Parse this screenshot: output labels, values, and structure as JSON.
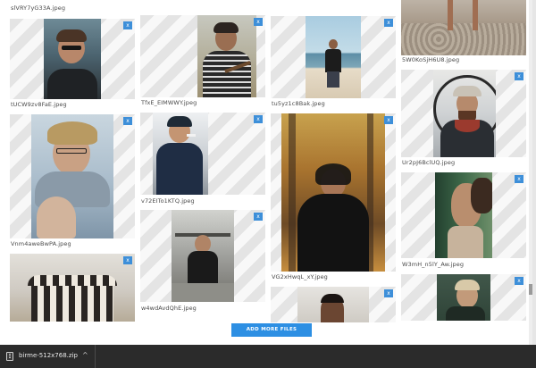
{
  "files": [
    {
      "name": "slVRY7yG33A.jpeg"
    },
    {
      "name": "tUCW9zv8FaE.jpeg"
    },
    {
      "name": "Vnm4aweBwPA.jpeg"
    },
    {
      "name": ""
    },
    {
      "name": ""
    },
    {
      "name": "TfxE_EIMWWY.jpeg"
    },
    {
      "name": "v72EITo1KTQ.jpeg"
    },
    {
      "name": "w4wdAvdQhE.jpeg"
    },
    {
      "name": ""
    },
    {
      "name": "tu5yz1c8Bak.jpeg"
    },
    {
      "name": "VG2xHwqL_xY.jpeg"
    },
    {
      "name": ""
    },
    {
      "name": "5W0KoSjH6U8.jpeg"
    },
    {
      "name": "Ur2pJ6BclUQ.jpeg"
    },
    {
      "name": "W3mH_n5lY_Aw.jpeg"
    },
    {
      "name": ""
    }
  ],
  "remove_label": "x",
  "add_more_label": "ADD MORE FILES",
  "download": {
    "filename": "birme-512x768.zip",
    "chevron": "^"
  },
  "colors": {
    "accent": "#2d8fe3",
    "remove": "#3d8fd9",
    "download_bar": "#2b2b2b"
  }
}
